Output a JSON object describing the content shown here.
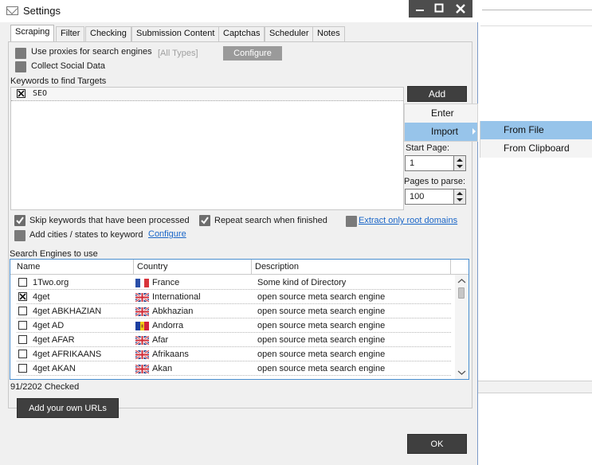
{
  "window": {
    "title": "Settings"
  },
  "tabs": [
    "Scraping",
    "Filter",
    "Checking",
    "Submission Content",
    "Captchas",
    "Scheduler",
    "Notes"
  ],
  "scraping": {
    "use_proxies_label": "Use proxies for search engines",
    "all_types_label": "[All Types]",
    "configure_button": "Configure",
    "collect_social_label": "Collect Social Data",
    "keywords_label": "Keywords to find Targets",
    "keywords": [
      {
        "text": "SEO",
        "checked": true
      }
    ],
    "add_button": "Add",
    "add_menu": {
      "items": [
        "Enter",
        "Import"
      ],
      "highlighted": "Import"
    },
    "import_submenu": {
      "items": [
        "From File",
        "From Clipboard"
      ],
      "highlighted": "From File"
    },
    "start_page_label": "Start Page:",
    "start_page_value": "1",
    "pages_to_parse_label": "Pages to parse:",
    "pages_to_parse_value": "100",
    "skip_keywords_label": "Skip keywords that have been processed",
    "repeat_search_label": "Repeat search when finished",
    "extract_root_link": "Extract only root domains",
    "add_cities_label": "Add cities / states to keyword",
    "add_cities_configure_link": "Configure",
    "engines_label": "Search Engines to use",
    "grid_headers": [
      "Name",
      "Country",
      "Description"
    ],
    "engines": [
      {
        "name": "1Two.org",
        "country": "France",
        "description": "Some kind of Directory",
        "checked": false,
        "flag": "france"
      },
      {
        "name": "4get",
        "country": "International",
        "description": "open source meta search engine",
        "checked": true,
        "flag": "uk"
      },
      {
        "name": "4get ABKHAZIAN",
        "country": "Abkhazian",
        "description": "open source meta search engine",
        "checked": false,
        "flag": "uk"
      },
      {
        "name": "4get AD",
        "country": "Andorra",
        "description": "open source meta search engine",
        "checked": false,
        "flag": "andorra"
      },
      {
        "name": "4get AFAR",
        "country": "Afar",
        "description": "open source meta search engine",
        "checked": false,
        "flag": "uk"
      },
      {
        "name": "4get AFRIKAANS",
        "country": "Afrikaans",
        "description": "open source meta search engine",
        "checked": false,
        "flag": "uk"
      },
      {
        "name": "4get AKAN",
        "country": "Akan",
        "description": "open source meta search engine",
        "checked": false,
        "flag": "uk"
      }
    ],
    "checked_count": "91/2202 Checked",
    "add_urls_button": "Add your own URLs",
    "ok_button": "OK"
  },
  "colors": {
    "menu_highlight": "#97c4ea",
    "link": "#1a66c8",
    "dark_button": "#3f3f3f"
  }
}
